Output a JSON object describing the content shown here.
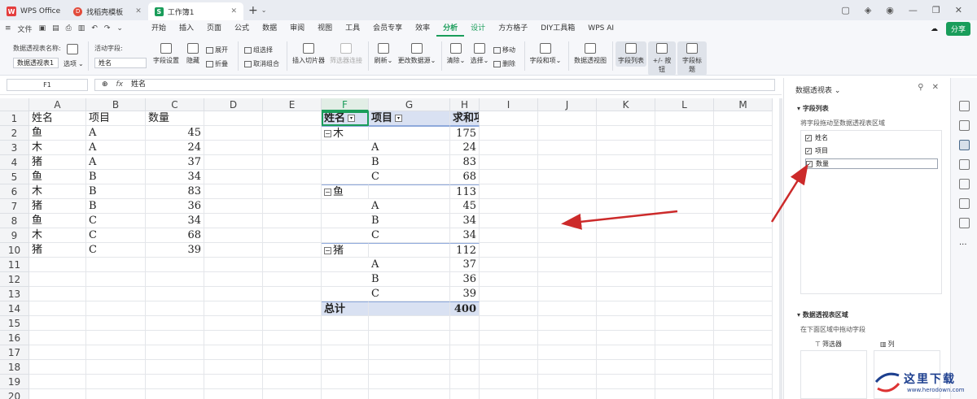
{
  "titlebar": {
    "tabs": [
      {
        "label": "WPS Office",
        "icon": "wps-logo"
      },
      {
        "label": "找稻壳模板",
        "icon": "docer-logo"
      },
      {
        "label": "工作簿1",
        "icon": "spreadsheet-logo"
      }
    ],
    "new_tab": "+"
  },
  "menubar": {
    "file": "文件",
    "items": [
      "开始",
      "插入",
      "页面",
      "公式",
      "数据",
      "审阅",
      "视图",
      "工具",
      "会员专享",
      "效率",
      "分析",
      "设计",
      "方方格子",
      "DIY工具箱",
      "WPS AI"
    ],
    "active": "分析",
    "share": "分享"
  },
  "ribbon": {
    "pivot_name_label": "数据透视表名称:",
    "pivot_name": "数据透视表1",
    "options": "选项",
    "active_field_label": "活动字段:",
    "active_field": "姓名",
    "field_settings": "字段设置",
    "hide": "隐藏",
    "expand": "展开",
    "collapse": "折叠",
    "group_select": "组选择",
    "ungroup": "取消组合",
    "insert_slicer": "插入切片器",
    "filter_connect": "筛选器连接",
    "refresh": "刷新",
    "change_source": "更改数据源",
    "clear": "清除",
    "select": "选择",
    "move": "移动",
    "delete": "删除",
    "fields_items": "字段和项",
    "pivot_chart": "数据透视图",
    "field_list": "字段列表",
    "plus_minus": "+/- 按钮",
    "field_headers": "字段标题"
  },
  "formulabar": {
    "namebox": "F1",
    "fx": "fx",
    "content": "姓名"
  },
  "grid": {
    "columns": [
      "A",
      "B",
      "C",
      "D",
      "E",
      "F",
      "G",
      "H",
      "I",
      "J",
      "K",
      "L",
      "M"
    ],
    "rows": [
      "1",
      "2",
      "3",
      "4",
      "5",
      "6",
      "7",
      "8",
      "9",
      "10",
      "11",
      "12",
      "13",
      "14",
      "15",
      "16",
      "17",
      "18",
      "19",
      "20"
    ],
    "source_header": [
      "姓名",
      "项目",
      "数量"
    ],
    "source_rows": [
      [
        "鱼",
        "A",
        "45"
      ],
      [
        "木",
        "A",
        "24"
      ],
      [
        "猪",
        "A",
        "37"
      ],
      [
        "鱼",
        "B",
        "34"
      ],
      [
        "木",
        "B",
        "83"
      ],
      [
        "猪",
        "B",
        "36"
      ],
      [
        "鱼",
        "C",
        "34"
      ],
      [
        "木",
        "C",
        "68"
      ],
      [
        "猪",
        "C",
        "39"
      ]
    ],
    "pivot_header": [
      "姓名",
      "项目",
      "求和项:数量"
    ],
    "pivot_groups": [
      {
        "name": "木",
        "total": "175",
        "items": [
          [
            "A",
            "24"
          ],
          [
            "B",
            "83"
          ],
          [
            "C",
            "68"
          ]
        ]
      },
      {
        "name": "鱼",
        "total": "113",
        "items": [
          [
            "A",
            "45"
          ],
          [
            "B",
            "34"
          ],
          [
            "C",
            "34"
          ]
        ]
      },
      {
        "name": "猪",
        "total": "112",
        "items": [
          [
            "A",
            "37"
          ],
          [
            "B",
            "36"
          ],
          [
            "C",
            "39"
          ]
        ]
      }
    ],
    "grand_total_label": "总计",
    "grand_total": "400"
  },
  "pane": {
    "title": "数据透视表",
    "field_list_title": "字段列表",
    "field_list_hint": "将字段拖动至数据透视表区域",
    "fields": [
      {
        "label": "姓名",
        "checked": true
      },
      {
        "label": "项目",
        "checked": true
      },
      {
        "label": "数量",
        "checked": true
      }
    ],
    "areas_title": "数据透视表区域",
    "areas_hint": "在下面区域中拖动字段",
    "filter_area": "筛选器",
    "column_area": "列"
  },
  "watermark": {
    "text": "这里下载",
    "sub": "www.herodown.com"
  },
  "colors": {
    "accent": "#1a9d5a",
    "pivot_header_bg": "#d9e1f2",
    "arrow": "#cc2a2a"
  }
}
